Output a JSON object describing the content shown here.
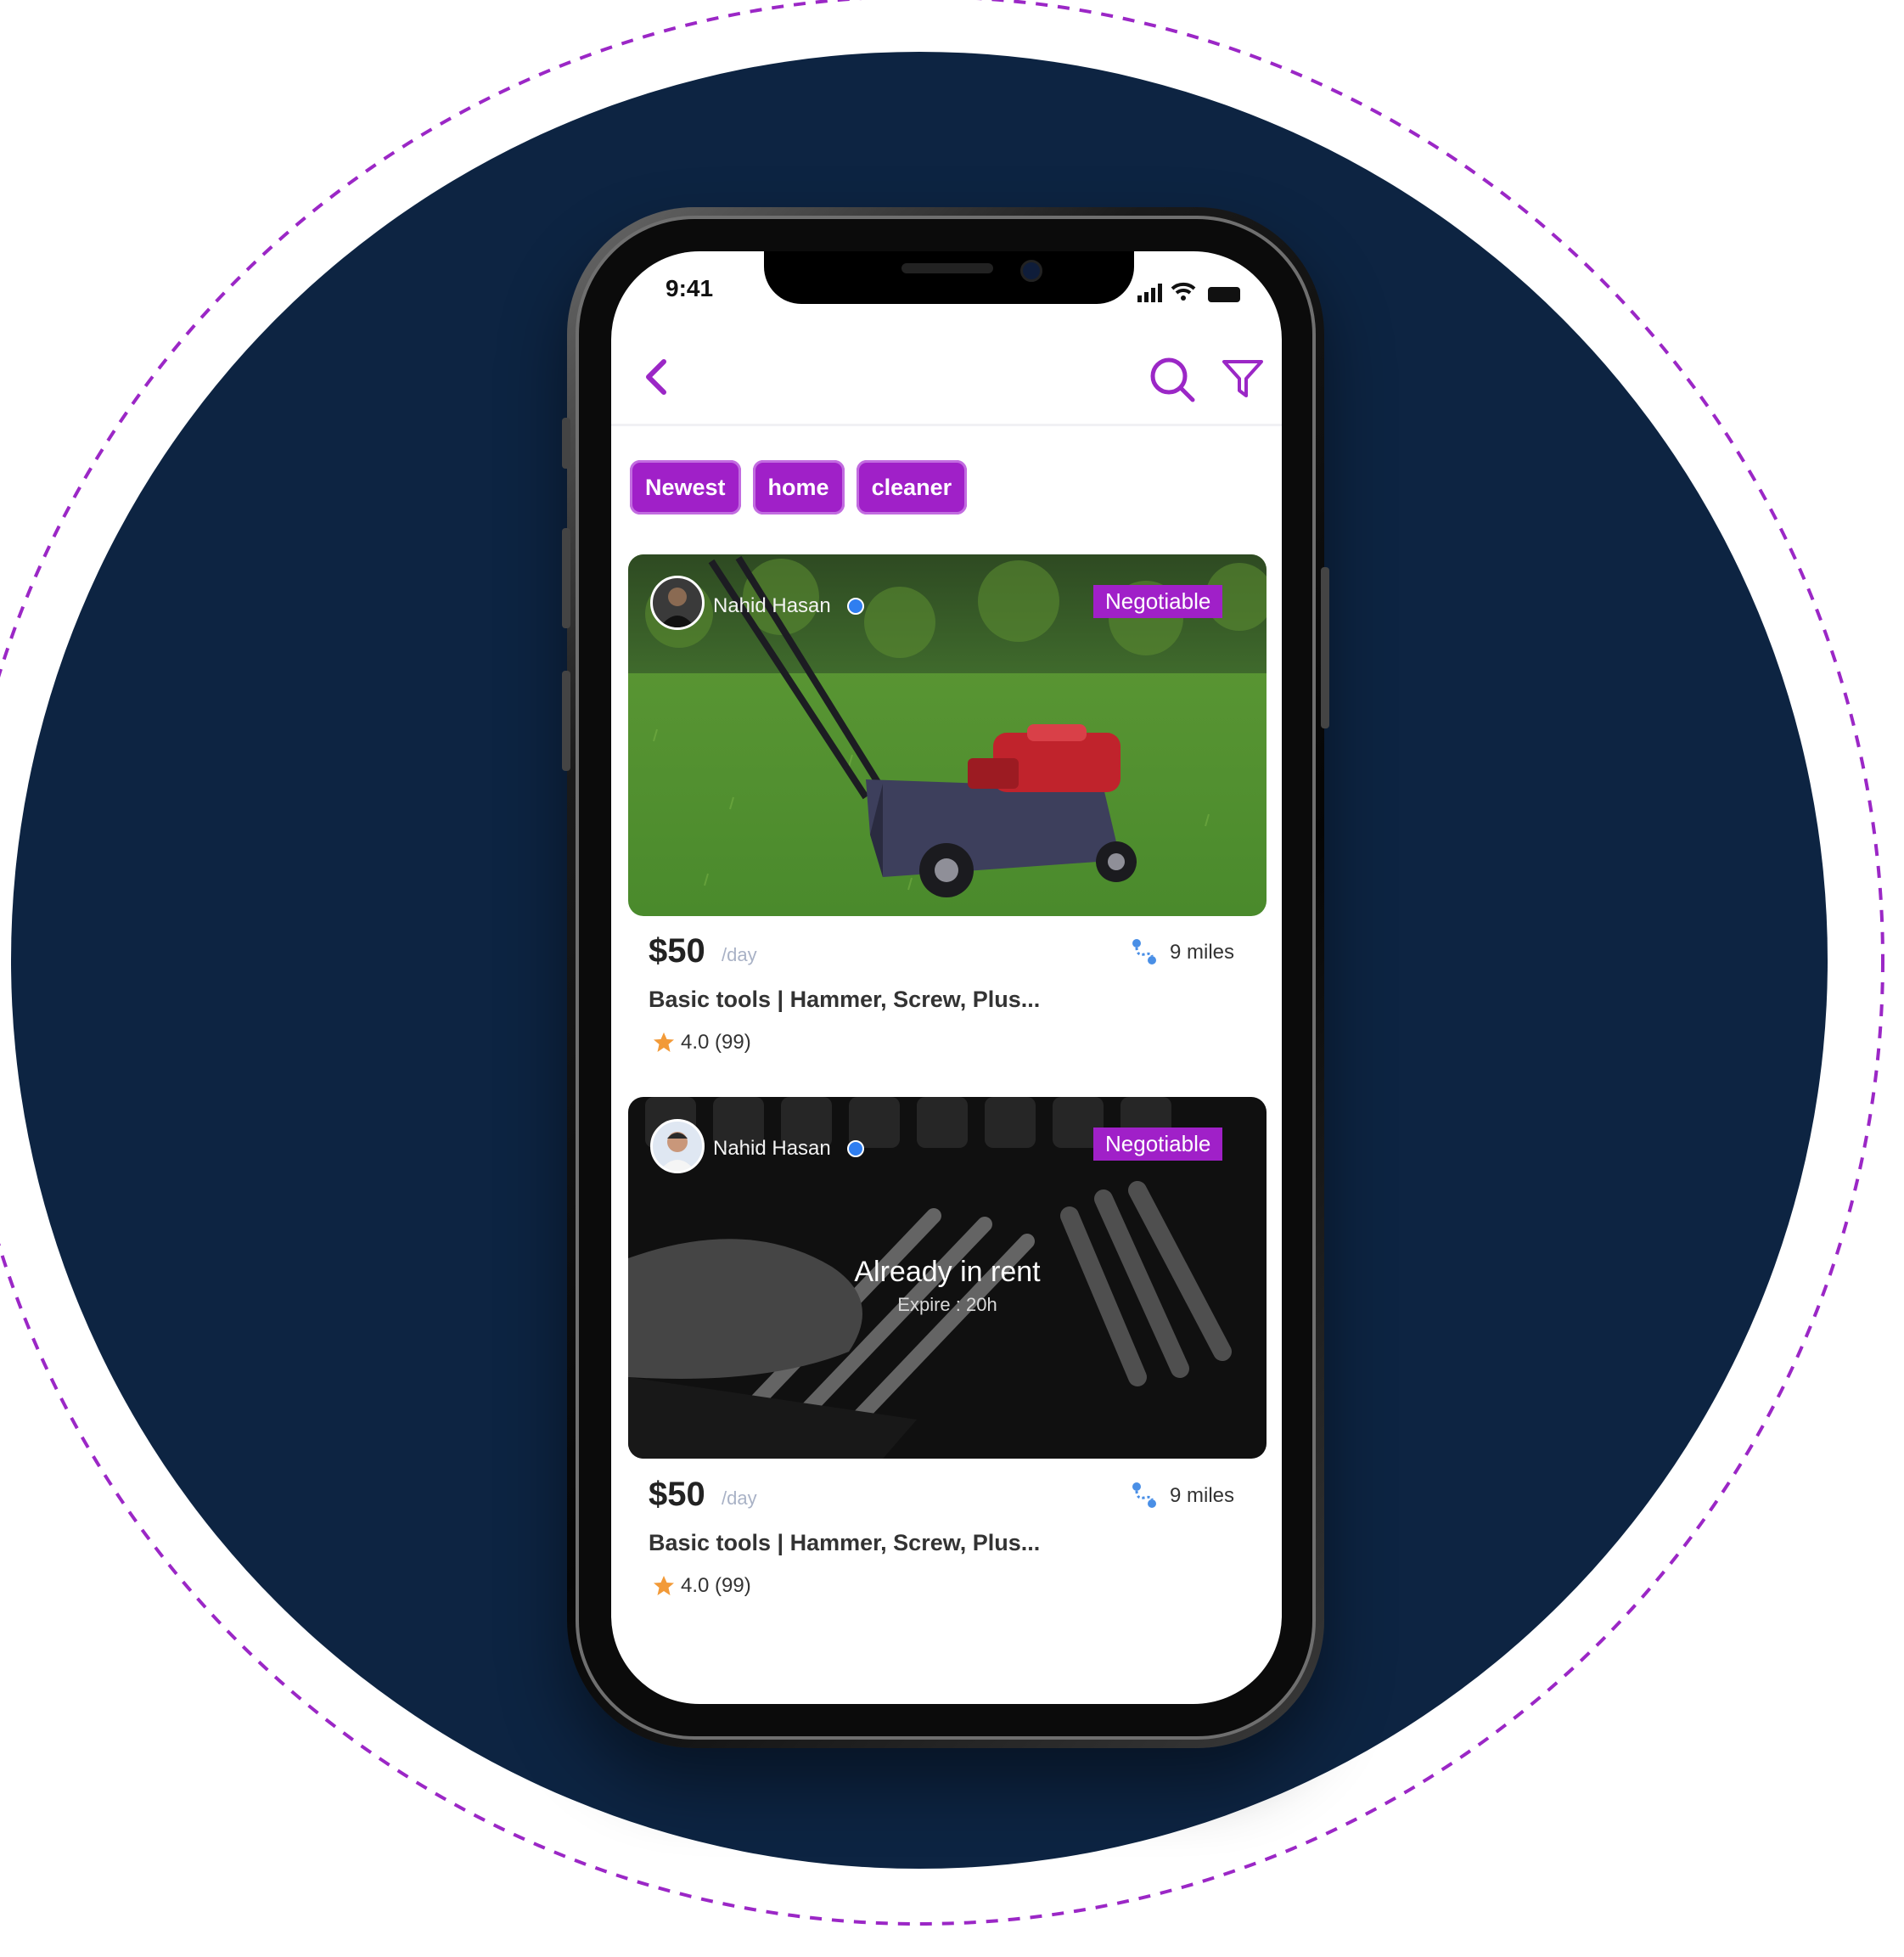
{
  "colors": {
    "circle": "#0d2442",
    "accent": "#a020c8",
    "dashed_ring": "#9b27c6",
    "verified": "#2f7ef0",
    "star": "#f29a38"
  },
  "status_bar": {
    "time": "9:41"
  },
  "header": {
    "icons": [
      "back-chevron-icon",
      "search-icon",
      "filter-icon"
    ]
  },
  "chips": [
    "Newest",
    "home",
    "cleaner"
  ],
  "listings": [
    {
      "owner": "Nahid Hasan",
      "verified": true,
      "badge": "Negotiable",
      "image": "lawn mower on grass",
      "overlay_title": "",
      "overlay_sub": "",
      "price": "$50",
      "unit": "/day",
      "distance": "9 miles",
      "title": "Basic tools | Hammer, Screw, Plus...",
      "rating": "4.0 (99)"
    },
    {
      "owner": "Nahid Hasan",
      "verified": true,
      "badge": "Negotiable",
      "image": "hand holding wrench over tool set (grayscale)",
      "overlay_title": "Already in rent",
      "overlay_sub": "Expire : 20h",
      "price": "$50",
      "unit": "/day",
      "distance": "9 miles",
      "title": "Basic tools | Hammer, Screw, Plus...",
      "rating": "4.0 (99)"
    }
  ]
}
